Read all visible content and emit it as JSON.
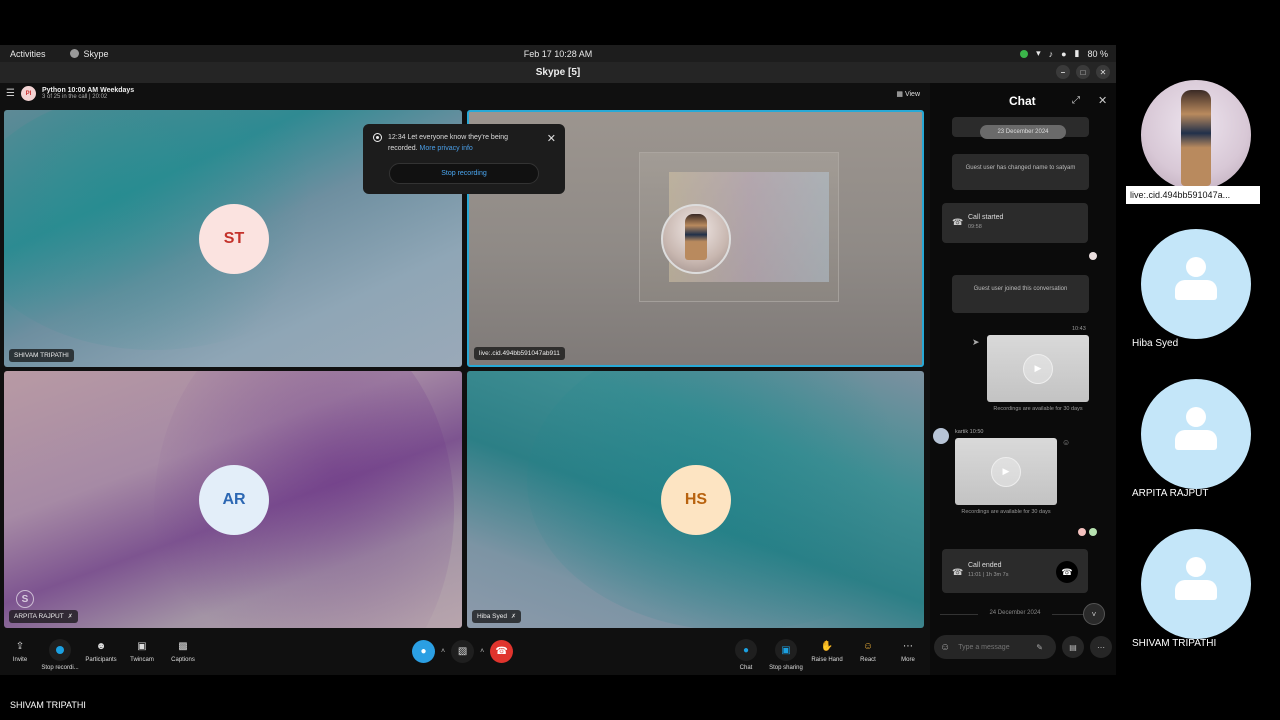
{
  "system_bar": {
    "activities": "Activities",
    "app_name": "Skype",
    "clock": "Feb 17  10:28 AM",
    "battery": "80 %"
  },
  "window": {
    "title": "Skype [5]"
  },
  "call": {
    "group_initials": "PI",
    "group_title": "Python 10:00 AM Weekdays",
    "group_subtitle": "3 of 25 in the call | 20:02",
    "view_label": "View",
    "tiles": [
      {
        "name": "SHIVAM TRIPATHI",
        "initials": "ST"
      },
      {
        "name": "live:.cid.494bb591047ab911",
        "initials": ""
      },
      {
        "name": "ARPITA RAJPUT",
        "initials": "AR"
      },
      {
        "name": "Hiba Syed",
        "initials": "HS"
      }
    ],
    "recording_notice": {
      "time": "12:34",
      "message": "Let everyone know they're being recorded.",
      "link": "More privacy info",
      "button": "Stop recording"
    }
  },
  "controls": {
    "invite": "Invite",
    "stop_recording": "Stop recordi...",
    "participants": "Participants",
    "twincam": "Twincam",
    "captions": "Captions",
    "chat": "Chat",
    "stop_sharing": "Stop sharing",
    "raise_hand": "Raise Hand",
    "react": "React",
    "more": "More"
  },
  "chat": {
    "title": "Chat",
    "system_msg_top": "...",
    "date_pill": "23 December 2024",
    "guest_renamed": "Guest user has changed name to satyam",
    "call_started": "Call started",
    "call_started_time": "09:58",
    "guest_joined": "Guest user joined this conversation",
    "time_1043": "10:43",
    "recording_caption": "Recordings are available for 30 days",
    "kartik_meta": "kartik  10:50",
    "call_ended": "Call ended",
    "call_ended_meta": "11:01 | 1h 3m 7s",
    "date_separator": "24 December 2024",
    "composer_placeholder": "Type a message"
  },
  "participants_panel": [
    {
      "name": "live:.cid.494bb591047a...",
      "type": "photo"
    },
    {
      "name": "Hiba Syed",
      "type": "default"
    },
    {
      "name": "ARPITA RAJPUT",
      "type": "default"
    },
    {
      "name": "SHIVAM TRIPATHI",
      "type": "default"
    }
  ],
  "footer": {
    "name": "SHIVAM TRIPATHI"
  },
  "colors": {
    "accent": "#1ba0e1",
    "end_call": "#e0342d",
    "avatar_panel": "#c4e6f9"
  }
}
